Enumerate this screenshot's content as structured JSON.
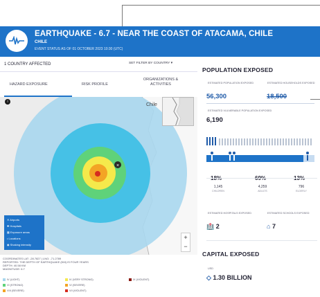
{
  "header": {
    "title": "EARTHQUAKE - 6.7 - NEAR THE COAST OF ATACAMA, CHILE",
    "country": "CHILE",
    "status": "EVENT STATUS AS OF 01 OCTOBER 2023 10:30 (UTC)"
  },
  "left": {
    "country_affected": "1 COUNTRY AFFECTED",
    "filter_label": "SET FILTER BY COUNTRY",
    "tabs": [
      "HAZARD EXPOSURE",
      "RISK PROFILE",
      "ORGANIZATIONS & ACTIVITIES"
    ],
    "inset_label": "Chile",
    "map_legend": [
      "Airports",
      "Hospitals",
      "Exposure areas",
      "Locations",
      "Shaking intensity"
    ],
    "coords_line1": "COORDINATES LAT: -28.7827 | LNG: -71.2789",
    "coords_line2": "REPORTED: THE DEPTH OF EARTHQUAKE (KM) IS FOUR YEARS",
    "coords_line3": "DEPTH: 40.58 KM",
    "coords_line4": "MAGNITUDE: 6.7",
    "mmi_levels": [
      "IV (LIGHT)",
      "VI (STRONG)",
      "VIII (SEVERE)",
      "V (MODERATE)",
      "VII (VERY STRONG)",
      "IX (VIOLENT)"
    ],
    "mmi_levels_extra": [
      "IV (VERY STRONG)",
      "VI (SEVERE)",
      "VII (VIOLENT)"
    ],
    "colors": {
      "map_ring_outer": "#a8d7ee",
      "map_ring_mid": "#46c1e6",
      "green": "#5fd27a",
      "yellow": "#f5e94b",
      "orange": "#f3a425",
      "red": "#d62b1f"
    }
  },
  "right": {
    "population_title": "POPULATION EXPOSED",
    "est_population_label": "ESTIMATED POPULATION EXPOSED",
    "est_population": "56,300",
    "est_households_label": "ESTIMATED HOUSEHOLDS EXPOSED",
    "est_households": "18,500",
    "vulnerable_label": "ESTIMATED VULNERABLE POPULATION EXPOSED",
    "vulnerable": "6,190",
    "pct_children": "18%",
    "children_count": "1,145",
    "children_label": "CHILDREN",
    "pct_adults": "69%",
    "adults_count": "4,259",
    "adults_label": "ADULTS",
    "pct_elderly": "13%",
    "elderly_count": "796",
    "elderly_label": "ELDERLY",
    "hospitals_label": "ESTIMATED HOSPITALS EXPOSED",
    "hospitals": "2",
    "schools_label": "ESTIMATED SCHOOLS EXPOSED",
    "schools": "7",
    "capital_title": "CAPITAL EXPOSED",
    "capital_currency": "USD",
    "capital_value": "1.30 BILLION"
  },
  "colors": {
    "brand": "#1e73c8",
    "dark": "#223"
  }
}
